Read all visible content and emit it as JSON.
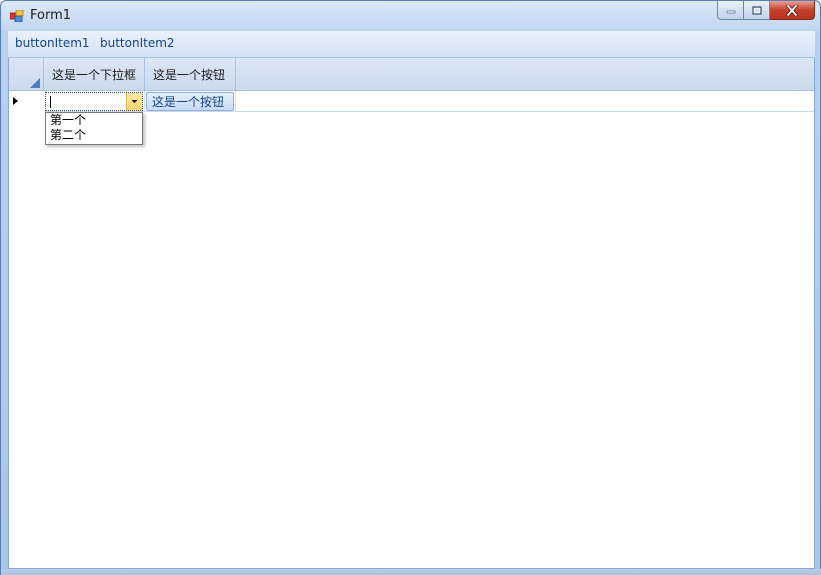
{
  "window": {
    "title": "Form1"
  },
  "menubar": {
    "items": [
      {
        "label": "buttonItem1"
      },
      {
        "label": "buttonItem2"
      }
    ]
  },
  "grid": {
    "columns": [
      {
        "header": "这是一个下拉框"
      },
      {
        "header": "这是一个按钮"
      }
    ],
    "rows": [
      {
        "combo_value": "",
        "button_label": "这是一个按钮"
      }
    ]
  },
  "dropdown": {
    "options": [
      "第一个",
      "第二个"
    ]
  },
  "colors": {
    "accent_text": "#15428b",
    "close_button": "#c5402b",
    "header_bg": "#cbdaee"
  },
  "icons": {
    "app": "form-app-icon",
    "minimize": "minimize-icon",
    "maximize": "maximize-icon",
    "close": "close-icon",
    "row_indicator": "row-pointer-icon",
    "dropdown": "chevron-down-icon"
  }
}
